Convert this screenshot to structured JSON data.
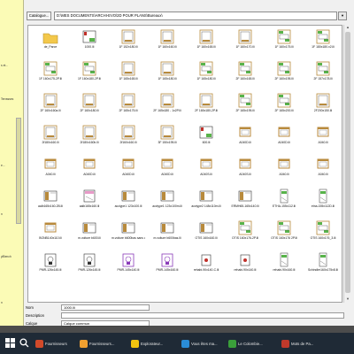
{
  "toolbar": {
    "catalog_label": "Catalogue...",
    "path": "D:\\MES DOCUMENTS\\ARCHI-EVO\\2D POUR PLANS\\Bureaux\\"
  },
  "left_panel": {
    "items": [
      "s et...",
      "Terrasses",
      "e...",
      "n",
      "ylBench",
      "n"
    ]
  },
  "tiles": [
    {
      "label": "de_Parce",
      "kind": "folder"
    },
    {
      "label": "1000.lli",
      "kind": "desk-red"
    },
    {
      "label": "1F 152x180.lli",
      "kind": "plan"
    },
    {
      "label": "1F 160x160.lli",
      "kind": "plan"
    },
    {
      "label": "1F 160x165.lli",
      "kind": "plan"
    },
    {
      "label": "1F 160x170.lli",
      "kind": "plan"
    },
    {
      "label": "1F 160x175.lli",
      "kind": "plan-green"
    },
    {
      "label": "1F 180x180.x2.lli",
      "kind": "plan-green"
    },
    {
      "label": "1F 160x175-2P.lli",
      "kind": "plan-green"
    },
    {
      "label": "1F 160x180-2P.lli",
      "kind": "plan-green"
    },
    {
      "label": "1F 165x165.lli",
      "kind": "plan"
    },
    {
      "label": "1F 165x180.lli",
      "kind": "plan"
    },
    {
      "label": "1F 165x180.lli",
      "kind": "plan-green"
    },
    {
      "label": "2F 160x165.lli",
      "kind": "plan-green"
    },
    {
      "label": "2F 160x195.lli",
      "kind": "plan-green"
    },
    {
      "label": "2F 157x178.lli",
      "kind": "plan-green"
    },
    {
      "label": "2F 160x160a.lli",
      "kind": "plan"
    },
    {
      "label": "2F 160x180.lli",
      "kind": "plan"
    },
    {
      "label": "2F 165x175.lli",
      "kind": "plan"
    },
    {
      "label": "2F 165x180 - 1x2P.lli",
      "kind": "plan"
    },
    {
      "label": "2F 165x180-2P.lli",
      "kind": "plan"
    },
    {
      "label": "2F 165x195.lli",
      "kind": "plan-green"
    },
    {
      "label": "2F 165x200.lli",
      "kind": "plan-green"
    },
    {
      "label": "2F200x150.lli",
      "kind": "plan"
    },
    {
      "label": "2f180x160.lli",
      "kind": "plan"
    },
    {
      "label": "2f180x160b.lli",
      "kind": "plan"
    },
    {
      "label": "2f160x160.lli",
      "kind": "plan"
    },
    {
      "label": "3F 150x195.lli",
      "kind": "plan"
    },
    {
      "label": "600.lli",
      "kind": "desk-red"
    },
    {
      "label": "A040D.lli",
      "kind": "chair"
    },
    {
      "label": "A040D.lli",
      "kind": "chair"
    },
    {
      "label": "A040.lli",
      "kind": "chair"
    },
    {
      "label": "A040.lli",
      "kind": "chair"
    },
    {
      "label": "A040D.lli",
      "kind": "chair"
    },
    {
      "label": "A040D.lli",
      "kind": "chair"
    },
    {
      "label": "A040D.lli",
      "kind": "chair"
    },
    {
      "label": "A040S.lli",
      "kind": "chair"
    },
    {
      "label": "A040S.lli",
      "kind": "chair"
    },
    {
      "label": "A040.lli",
      "kind": "chair"
    },
    {
      "label": "A040.lli",
      "kind": "chair"
    },
    {
      "label": "aalb165x160-2B.lli",
      "kind": "desk"
    },
    {
      "label": "aalb165x160.lli",
      "kind": "desk-pink"
    },
    {
      "label": "acctype1 123x100.lli",
      "kind": "desk"
    },
    {
      "label": "acctype1 123x100m.lli",
      "kind": "desk"
    },
    {
      "label": "acctype2 148x110m.lli",
      "kind": "desk"
    },
    {
      "label": "ERMH65-165x140.lli",
      "kind": "desk"
    },
    {
      "label": "ETHA-155x112.lli",
      "kind": "plan-slim"
    },
    {
      "label": "etna-155x112D.lli",
      "kind": "plan-slim"
    },
    {
      "label": "BONB140x110.lli",
      "kind": "chair"
    },
    {
      "label": "m.voiture b600.lli",
      "kind": "desk"
    },
    {
      "label": "m.voiture b600bas sans cote.lli",
      "kind": "desk"
    },
    {
      "label": "m.voiture b600bas.lli",
      "kind": "desk"
    },
    {
      "label": "OTIS 160x160.lli",
      "kind": "desk"
    },
    {
      "label": "OTIS 160x176-2P.lli",
      "kind": "plan-green"
    },
    {
      "label": "OTIS 160x176 2P.lli",
      "kind": "plan-green"
    },
    {
      "label": "OTIS 160x176_3.lli",
      "kind": "plan-green"
    },
    {
      "label": "PMR-126x145.lli",
      "kind": "pmr"
    },
    {
      "label": "PMR-126x145.lli",
      "kind": "pmr"
    },
    {
      "label": "PMR-145x140.lli",
      "kind": "pmr-purple"
    },
    {
      "label": "PMR-145x160.lli",
      "kind": "pmr-purple"
    },
    {
      "label": "rehabi-90x140-C.lli",
      "kind": "desk-small"
    },
    {
      "label": "rehabi-90x140.lli",
      "kind": "desk-small"
    },
    {
      "label": "rehabi-90x160.lli",
      "kind": "plan-slim"
    },
    {
      "label": "Schindler160x175x8.lli",
      "kind": "plan-slim"
    }
  ],
  "properties": {
    "name_label": "Nom",
    "name_value": "1000.lli",
    "desc_label": "Description",
    "desc_value": "",
    "layer_label": "Calque",
    "layer_value": "Calque commun"
  },
  "taskbar": {
    "items": [
      {
        "label": "Fournisseurs",
        "color": "#d24a2a"
      },
      {
        "label": "Fournisseurs...",
        "color": "#f0a030"
      },
      {
        "label": "Explorateur...",
        "color": "#f1c40f"
      },
      {
        "label": "Vous êtes ma...",
        "color": "#2a8cd6"
      },
      {
        "label": "Le Colombie...",
        "color": "#3a9f3a"
      },
      {
        "label": "Mots de Pa...",
        "color": "#c0392b"
      }
    ]
  },
  "colors": {
    "taskbar": "#1f2a36",
    "left_panel": "#fbfbb6",
    "plan_green": "#58b34a",
    "plan_brown": "#b88a3c",
    "desk_red": "#c0302a",
    "purple": "#8a3ab9"
  }
}
